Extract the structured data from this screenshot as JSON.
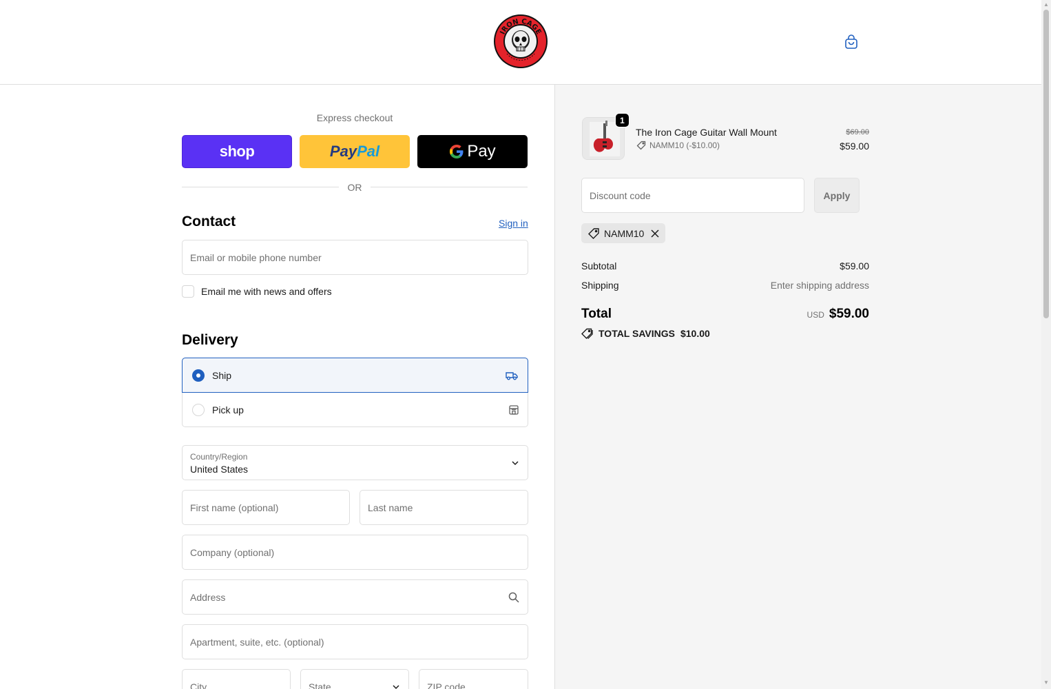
{
  "header": {
    "logo_text": "IRON CAGE",
    "cart_icon": "shopping-bag-icon"
  },
  "express": {
    "title": "Express checkout",
    "shop_label": "shop",
    "paypal_label_1": "Pay",
    "paypal_label_2": "Pal",
    "gpay_g": "G",
    "gpay_label": "Pay",
    "or_text": "OR"
  },
  "contact": {
    "title": "Contact",
    "signin_label": "Sign in",
    "email_placeholder": "Email or mobile phone number",
    "news_label": "Email me with news and offers"
  },
  "delivery": {
    "title": "Delivery",
    "options": [
      {
        "label": "Ship",
        "selected": true,
        "icon": "truck-icon"
      },
      {
        "label": "Pick up",
        "selected": false,
        "icon": "store-icon"
      }
    ]
  },
  "address": {
    "country_label": "Country/Region",
    "country_value": "United States",
    "first_name_placeholder": "First name (optional)",
    "last_name_placeholder": "Last name",
    "company_placeholder": "Company (optional)",
    "address_placeholder": "Address",
    "apartment_placeholder": "Apartment, suite, etc. (optional)",
    "city_placeholder": "City",
    "state_placeholder": "State",
    "zip_placeholder": "ZIP code"
  },
  "summary": {
    "product": {
      "name": "The Iron Cage Guitar Wall Mount",
      "quantity": "1",
      "discount_line": "NAMM10 (-$10.00)",
      "price_original": "$69.00",
      "price_final": "$59.00"
    },
    "discount_placeholder": "Discount code",
    "apply_label": "Apply",
    "applied_code": "NAMM10",
    "subtotal_label": "Subtotal",
    "subtotal_value": "$59.00",
    "shipping_label": "Shipping",
    "shipping_value": "Enter shipping address",
    "total_label": "Total",
    "total_currency": "USD",
    "total_value": "$59.00",
    "savings_label": "TOTAL SAVINGS",
    "savings_value": "$10.00"
  },
  "colors": {
    "accent": "#1f5fbf",
    "shop_purple": "#5a31f4",
    "paypal_yellow": "#ffc439",
    "logo_red": "#e4232b"
  }
}
